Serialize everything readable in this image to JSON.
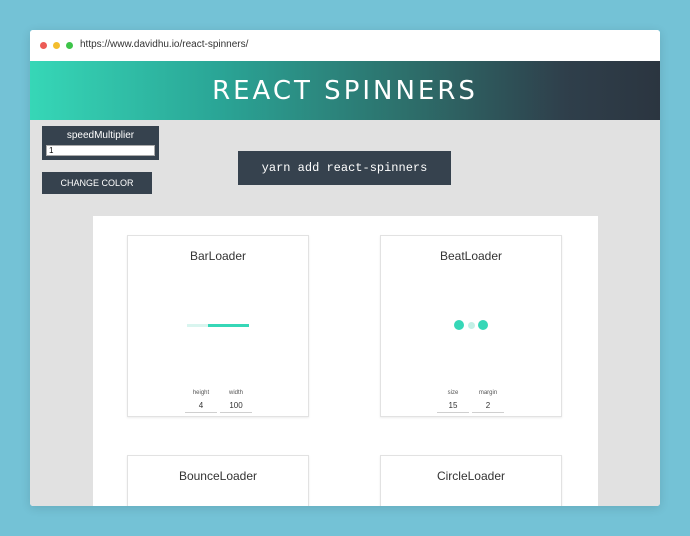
{
  "browser": {
    "url": "https://www.davidhu.io/react-spinners/"
  },
  "header": {
    "title": "REACT SPINNERS"
  },
  "controls": {
    "speed_label": "speedMultiplier",
    "speed_value": "1",
    "change_color_label": "CHANGE COLOR",
    "install_command": "yarn add react-spinners"
  },
  "colors": {
    "accent": "#36d7b7",
    "dark": "#36424e",
    "background": "#e1e1e1"
  },
  "loaders": [
    {
      "name": "BarLoader",
      "props": [
        {
          "label": "height",
          "value": "4"
        },
        {
          "label": "width",
          "value": "100"
        }
      ]
    },
    {
      "name": "BeatLoader",
      "props": [
        {
          "label": "size",
          "value": "15"
        },
        {
          "label": "margin",
          "value": "2"
        }
      ]
    },
    {
      "name": "BounceLoader"
    },
    {
      "name": "CircleLoader"
    }
  ]
}
